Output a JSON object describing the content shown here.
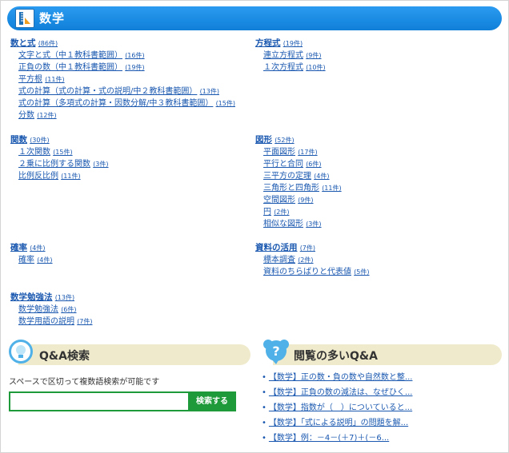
{
  "header": {
    "title": "数学"
  },
  "left_groups": [
    {
      "title": "数と式",
      "count": "(86件)",
      "items": [
        {
          "label": "文字と式（中１教科書範囲）",
          "count": "(16件)"
        },
        {
          "label": "正負の数（中１教科書範囲）",
          "count": "(19件)"
        },
        {
          "label": "平方根",
          "count": "(11件)"
        },
        {
          "label": "式の計算（式の計算・式の説明/中２教科書範囲）",
          "count": "(13件)"
        },
        {
          "label": "式の計算（多項式の計算・因数分解/中３教科書範囲）",
          "count": "(15件)"
        },
        {
          "label": "分数",
          "count": "(12件)"
        }
      ]
    },
    {
      "title": "関数",
      "count": "(30件)",
      "items": [
        {
          "label": "１次関数",
          "count": "(15件)"
        },
        {
          "label": "２乗に比例する関数",
          "count": "(3件)"
        },
        {
          "label": "比例反比例",
          "count": "(11件)"
        }
      ]
    },
    {
      "title": "確率",
      "count": "(4件)",
      "items": [
        {
          "label": "確率",
          "count": "(4件)"
        }
      ]
    },
    {
      "title": "数学勉強法",
      "count": "(13件)",
      "items": [
        {
          "label": "数学勉強法",
          "count": "(6件)"
        },
        {
          "label": "数学用語の説明",
          "count": "(7件)"
        }
      ]
    }
  ],
  "right_groups": [
    {
      "title": "方程式",
      "count": "(19件)",
      "items": [
        {
          "label": "連立方程式",
          "count": "(9件)"
        },
        {
          "label": "１次方程式",
          "count": "(10件)"
        }
      ]
    },
    {
      "title": "図形",
      "count": "(52件)",
      "items": [
        {
          "label": "平面図形",
          "count": "(17件)"
        },
        {
          "label": "平行と合同",
          "count": "(6件)"
        },
        {
          "label": "三平方の定理",
          "count": "(4件)"
        },
        {
          "label": "三角形と四角形",
          "count": "(11件)"
        },
        {
          "label": "空間図形",
          "count": "(9件)"
        },
        {
          "label": "円",
          "count": "(2件)"
        },
        {
          "label": "相似な図形",
          "count": "(3件)"
        }
      ]
    },
    {
      "title": "資料の活用",
      "count": "(7件)",
      "items": [
        {
          "label": "標本調査",
          "count": "(2件)"
        },
        {
          "label": "資料のちらばりと代表値",
          "count": "(5件)"
        }
      ]
    }
  ],
  "qa_search": {
    "title": "Q&A検索",
    "description": "スペースで区切って複数語検索が可能です",
    "input_value": "",
    "button_label": "検索する"
  },
  "popular_qa": {
    "title": "閲覧の多いQ&A",
    "items": [
      "【数学】正の数・負の数や自然数と整...",
      "【数学】正負の数の減法は、なぜひく...",
      "【数学】指数が（　）についていると...",
      "【数学】「式による説明」の問題を解...",
      "【数学】例：－4－(＋7)＋(－6..."
    ]
  },
  "colors": {
    "header_blue": "#1a8ae0",
    "link_blue": "#1a58b0",
    "qa_bar": "#efeacb",
    "search_green": "#1f9a3a"
  }
}
